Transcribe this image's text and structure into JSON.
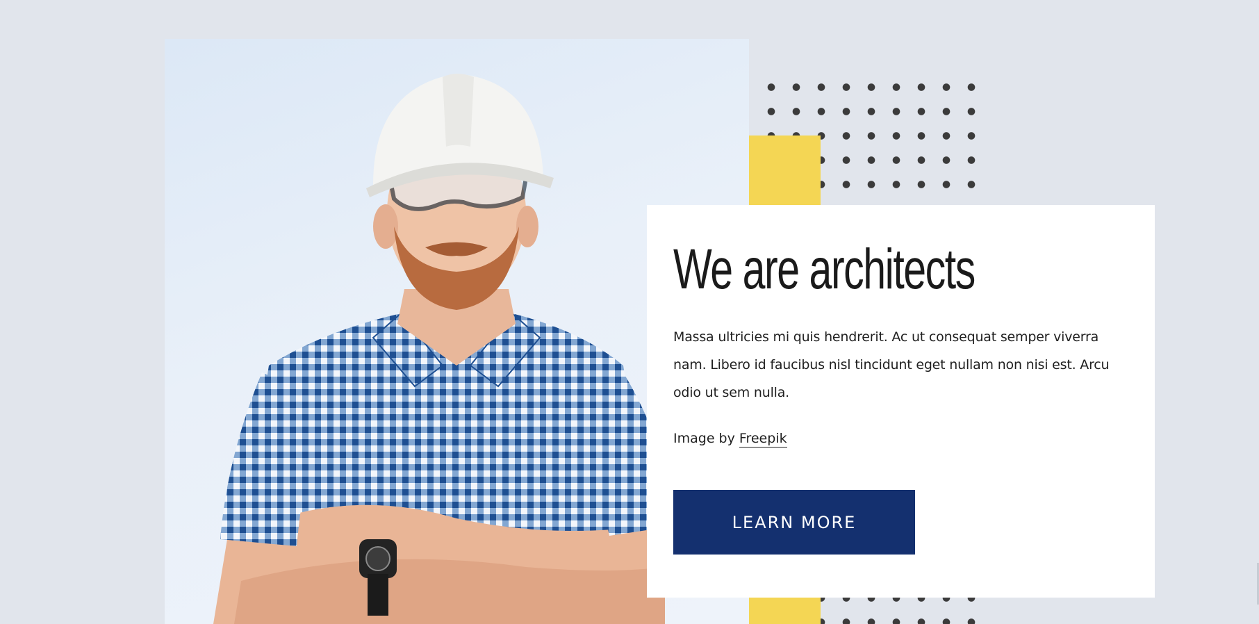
{
  "section": {
    "heading": "We are architects",
    "body": "Massa ultricies mi quis hendrerit. Ac ut consequat semper viverra nam. Libero id faucibus nisl tincidunt eget nullam non nisi est. Arcu odio ut sem nulla.",
    "credit_prefix": "Image by",
    "credit_link": "Freepik",
    "cta_label": "LEARN MORE"
  },
  "colors": {
    "page_background": "#e1e5ec",
    "accent_yellow": "#f4d654",
    "button_navy": "#14306f",
    "dots": "#3b3b3b",
    "card_background": "#ffffff"
  },
  "icons": {
    "photo": "architect-photo"
  }
}
